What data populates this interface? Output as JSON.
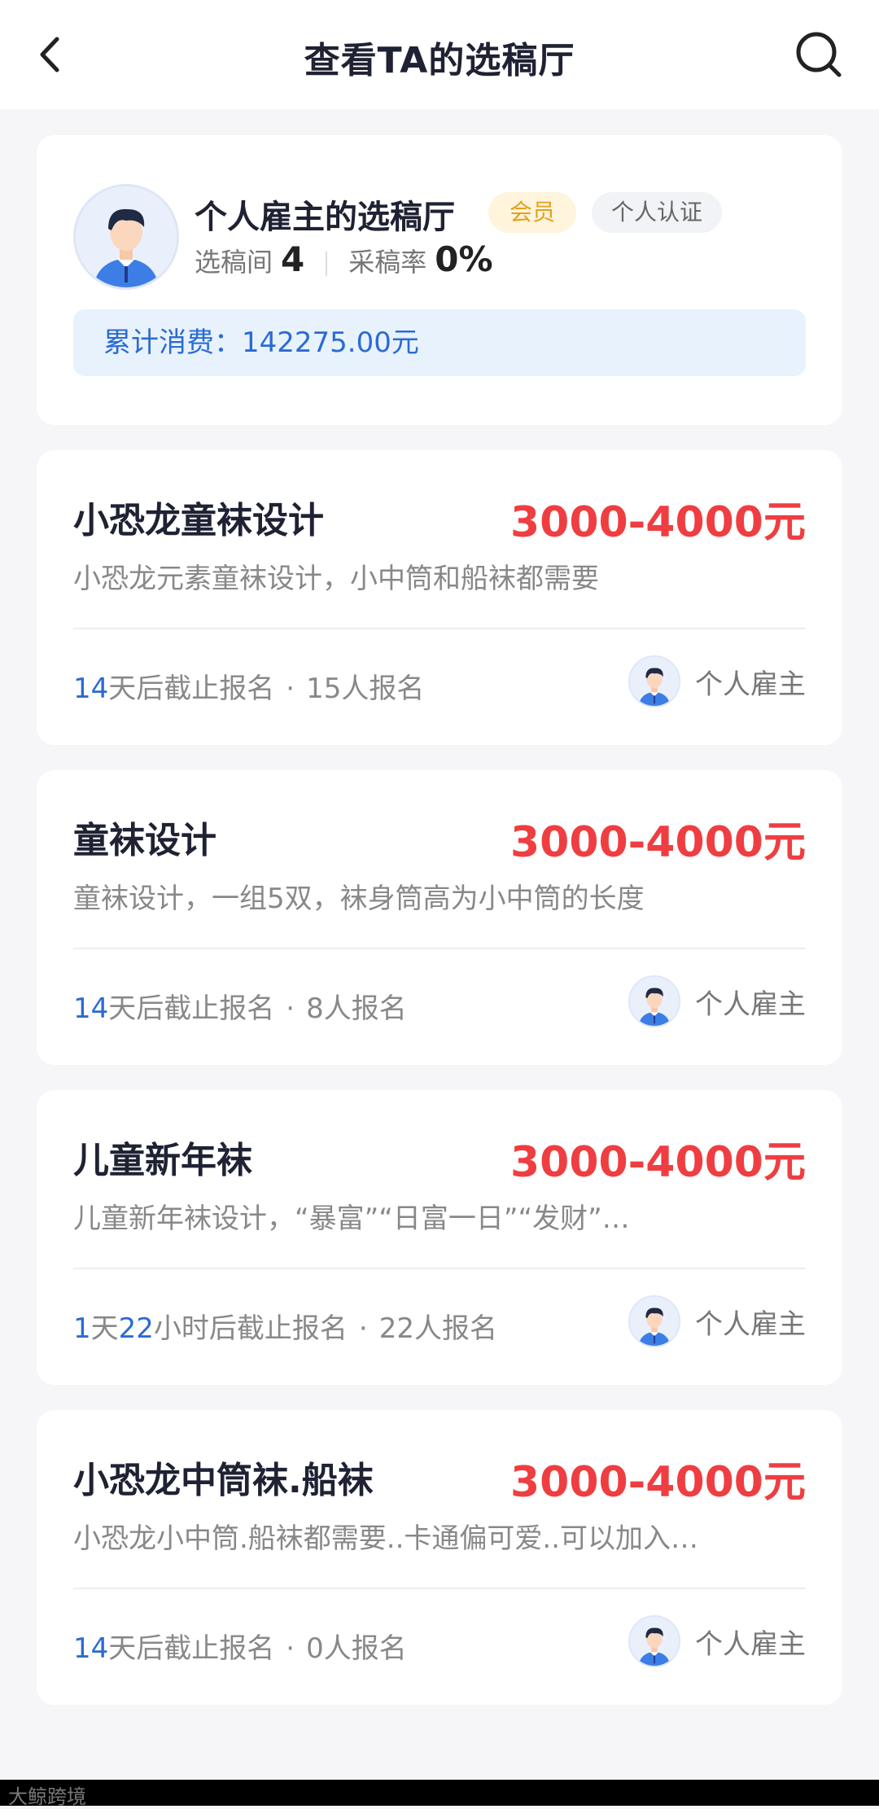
{
  "header": {
    "title": "查看TA的选稿厅",
    "back_icon": "chevron-left-icon",
    "search_icon": "search-icon"
  },
  "profile": {
    "name": "个人雇主的选稿厅",
    "badge_vip": "会员",
    "badge_cert": "个人认证",
    "rooms_label": "选稿间",
    "rooms_value": "4",
    "adopt_label": "采稿率",
    "adopt_value": "0%",
    "spend_text": "累计消费：142275.00元"
  },
  "tasks": [
    {
      "title": "小恐龙童袜设计",
      "price": "3000-4000元",
      "desc": "小恐龙元素童袜设计，小中筒和船袜都需要",
      "deadline_parts": [
        {
          "text": "14",
          "hl": true
        },
        {
          "text": "天后截止报名",
          "hl": false
        }
      ],
      "signups": "15人报名",
      "poster": "个人雇主"
    },
    {
      "title": "童袜设计",
      "price": "3000-4000元",
      "desc": "童袜设计，一组5双，袜身筒高为小中筒的长度",
      "deadline_parts": [
        {
          "text": "14",
          "hl": true
        },
        {
          "text": "天后截止报名",
          "hl": false
        }
      ],
      "signups": "8人报名",
      "poster": "个人雇主"
    },
    {
      "title": "儿童新年袜",
      "price": "3000-4000元",
      "desc": "儿童新年袜设计，“暴富”“日富一日”“发财”…",
      "deadline_parts": [
        {
          "text": "1",
          "hl": true
        },
        {
          "text": "天",
          "hl": false
        },
        {
          "text": "22",
          "hl": true
        },
        {
          "text": "小时后截止报名",
          "hl": false
        }
      ],
      "signups": "22人报名",
      "poster": "个人雇主"
    },
    {
      "title": "小恐龙中筒袜.船袜",
      "price": "3000-4000元",
      "desc": "小恐龙小中筒.船袜都需要..卡通偏可爱..可以加入…",
      "deadline_parts": [
        {
          "text": "14",
          "hl": true
        },
        {
          "text": "天后截止报名",
          "hl": false
        }
      ],
      "signups": "0人报名",
      "poster": "个人雇主"
    }
  ],
  "footer": {
    "watermark": "大鲸跨境"
  },
  "colors": {
    "accent_blue": "#2b6bd2",
    "price_red": "#ef3e41",
    "vip_gold": "#e4a11b"
  }
}
